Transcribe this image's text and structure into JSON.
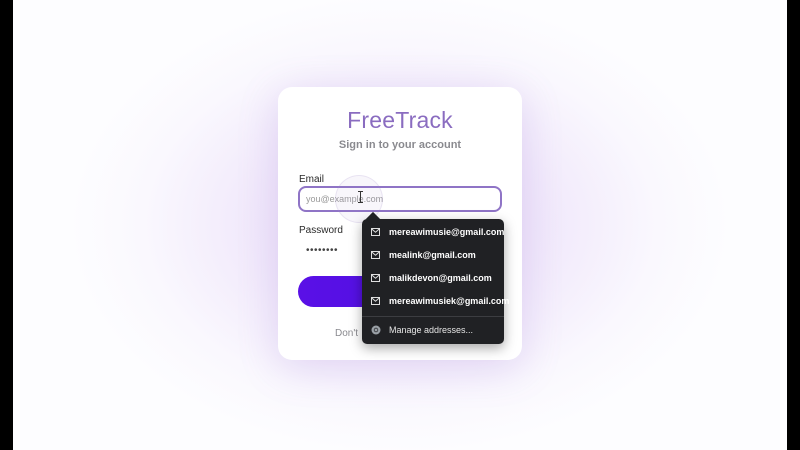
{
  "app": {
    "brand": "FreeTrack",
    "subtitle": "Sign in to your account"
  },
  "form": {
    "email_label": "Email",
    "email_placeholder": "you@example.com",
    "email_value": "",
    "password_label": "Password",
    "password_value": "••••••••",
    "signin_label": "",
    "signup_text": "Don't"
  },
  "autofill": {
    "suggestions": [
      "mereawimusie@gmail.com",
      "mealink@gmail.com",
      "malikdevon@gmail.com",
      "mereawimusiek@gmail.com"
    ],
    "manage_label": "Manage addresses...",
    "suggestion_icon": "mail-icon",
    "manage_icon": "chrome-icon"
  },
  "colors": {
    "brand": "#8a6cc0",
    "primary_button": "#5a10e6",
    "input_focus_border": "#8f74c6",
    "dropdown_bg": "#202124"
  }
}
